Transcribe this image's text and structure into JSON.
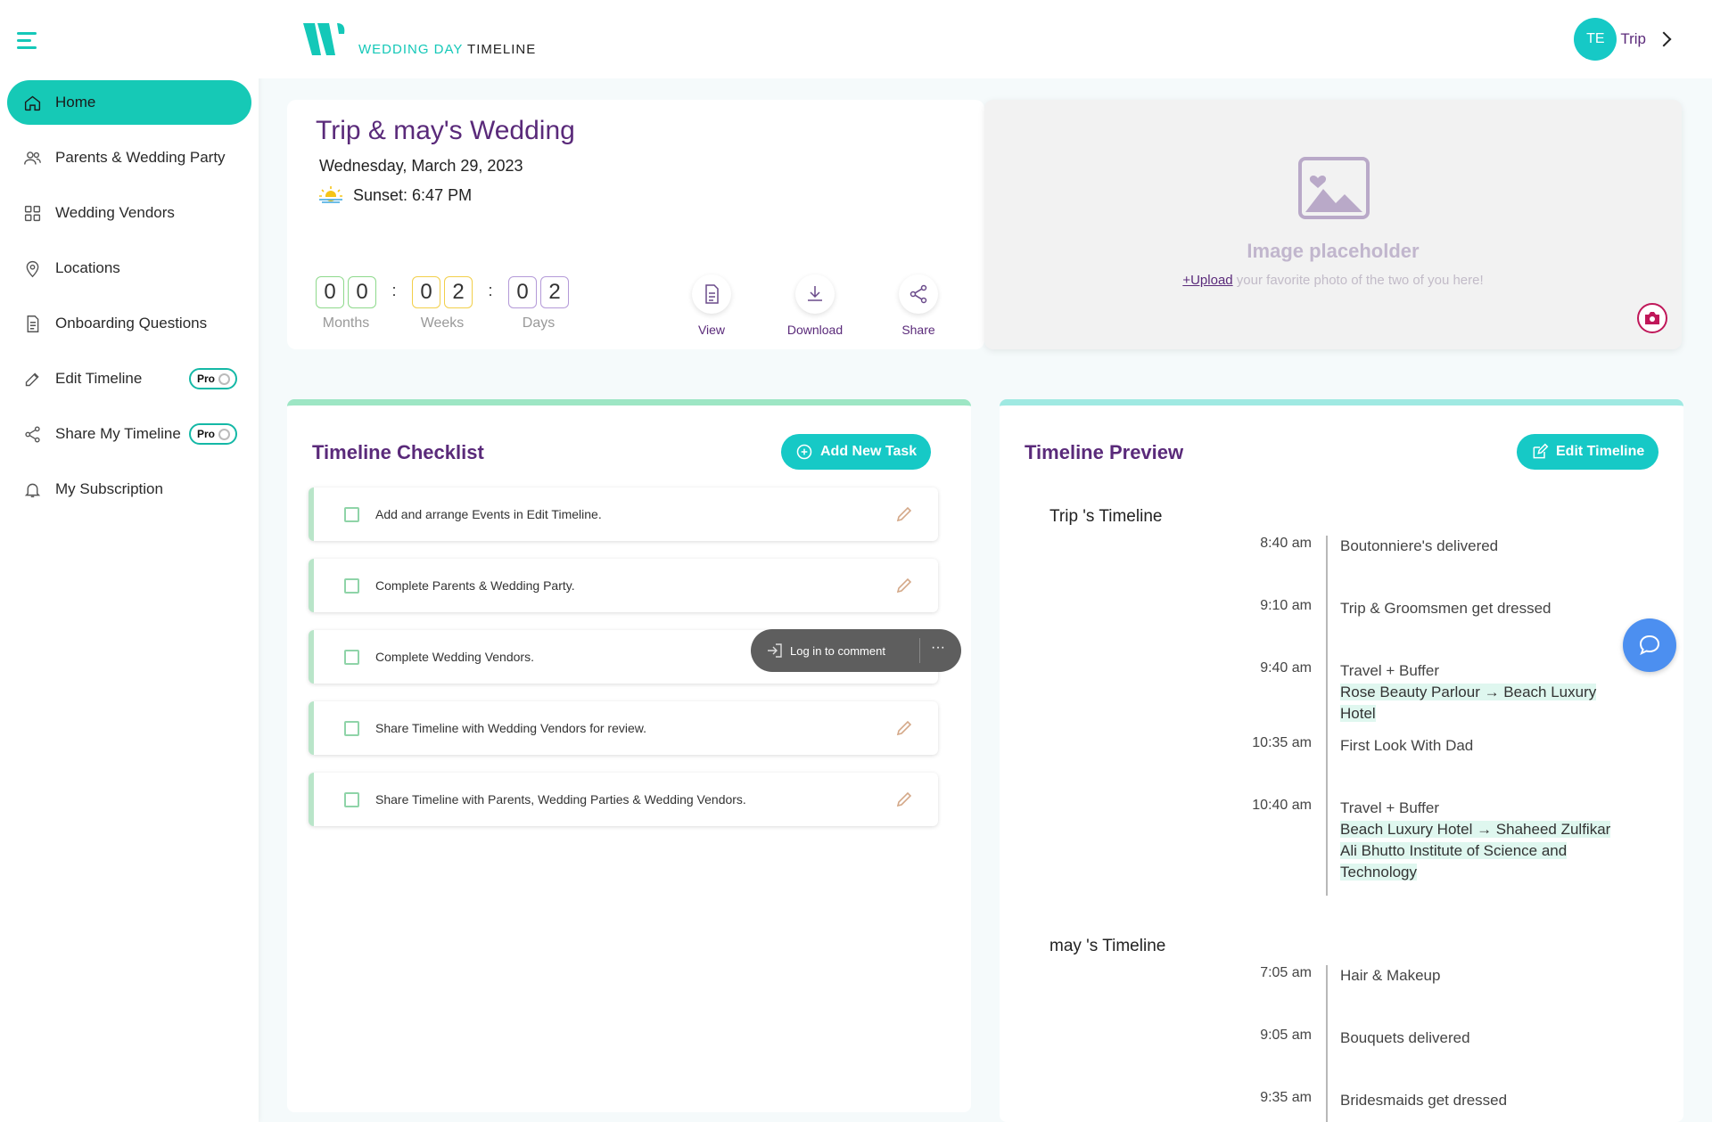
{
  "app": {
    "logo_part1": "WEDDING DAY",
    "logo_part2": "TIMELINE"
  },
  "user": {
    "initials": "TE",
    "name": "Trip"
  },
  "sidebar": {
    "items": [
      {
        "label": "Home",
        "icon": "home-icon",
        "active": true
      },
      {
        "label": "Parents & Wedding Party",
        "icon": "users-icon"
      },
      {
        "label": "Wedding Vendors",
        "icon": "grid-icon"
      },
      {
        "label": "Locations",
        "icon": "location-pin-icon"
      },
      {
        "label": "Onboarding Questions",
        "icon": "document-icon"
      },
      {
        "label": "Edit Timeline",
        "icon": "edit-icon",
        "badge": "Pro"
      },
      {
        "label": "Share My Timeline",
        "icon": "share-icon",
        "badge": "Pro"
      },
      {
        "label": "My Subscription",
        "icon": "bell-icon"
      }
    ]
  },
  "hero": {
    "title": "Trip & may's Wedding",
    "date": "Wednesday, March 29, 2023",
    "sunset": "Sunset: 6:47 PM",
    "countdown": {
      "months": {
        "d1": "0",
        "d2": "0",
        "label": "Months"
      },
      "weeks": {
        "d1": "0",
        "d2": "2",
        "label": "Weeks"
      },
      "days": {
        "d1": "0",
        "d2": "2",
        "label": "Days"
      },
      "separator": ":"
    },
    "actions": {
      "view": "View",
      "download": "Download",
      "share": "Share"
    }
  },
  "image": {
    "title": "Image placeholder",
    "upload_link": "+Upload",
    "upload_text": " your favorite photo of the two of you here!"
  },
  "checklist": {
    "title": "Timeline Checklist",
    "add_button": "Add New Task",
    "tasks": [
      "Add and arrange Events in Edit Timeline.",
      "Complete Parents & Wedding Party.",
      "Complete Wedding Vendors.",
      "Share Timeline with Wedding Vendors for review.",
      "Share Timeline with Parents, Wedding Parties & Wedding Vendors."
    ],
    "tooltip": {
      "label": "Log in to comment",
      "more": "···"
    }
  },
  "preview": {
    "title": "Timeline Preview",
    "edit_button": "Edit Timeline",
    "sections": [
      {
        "name": "Trip 's Timeline",
        "events": [
          {
            "time": "8:40 am",
            "title": "Boutonniere's delivered",
            "route": ""
          },
          {
            "time": "9:10 am",
            "title": "Trip & Groomsmen get dressed",
            "route": ""
          },
          {
            "time": "9:40 am",
            "title": "Travel + Buffer",
            "route": "Rose Beauty Parlour → Beach Luxury Hotel"
          },
          {
            "time": "10:35 am",
            "title": "First Look With Dad",
            "route": ""
          },
          {
            "time": "10:40 am",
            "title": "Travel + Buffer",
            "route": "Beach Luxury Hotel → Shaheed Zulfikar Ali Bhutto Institute of Science and Technology"
          }
        ]
      },
      {
        "name": "may 's Timeline",
        "events": [
          {
            "time": "7:05 am",
            "title": "Hair & Makeup",
            "route": ""
          },
          {
            "time": "9:05 am",
            "title": "Bouquets delivered",
            "route": ""
          },
          {
            "time": "9:35 am",
            "title": "Bridesmaids get dressed",
            "route": ""
          }
        ]
      }
    ]
  },
  "colors": {
    "accent": "#16c9b6",
    "brand_purple": "#5a2a7a",
    "chat_blue": "#4c8ff0"
  }
}
